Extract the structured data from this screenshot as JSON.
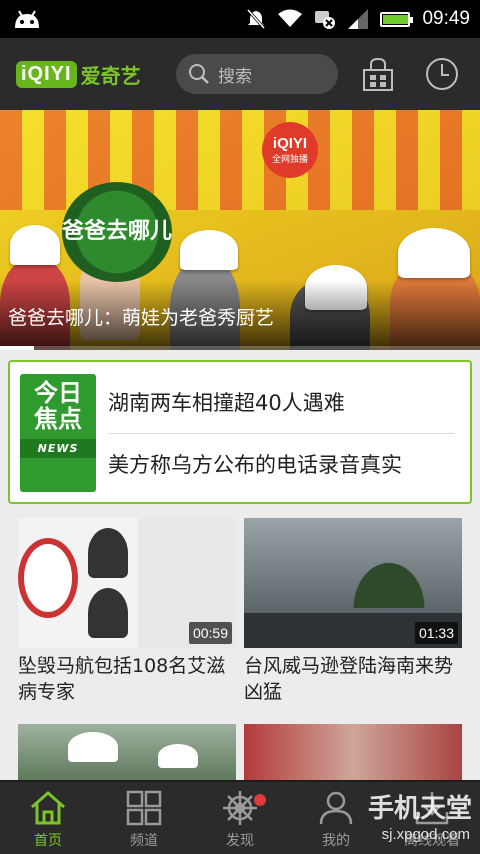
{
  "status_bar": {
    "time": "09:49",
    "battery_level": 0.95,
    "icons": [
      "android-icon",
      "mute-icon",
      "wifi-icon",
      "sync-off-icon",
      "signal-icon",
      "battery-icon"
    ]
  },
  "header": {
    "logo_mark": "iQIYI",
    "logo_name": "爱奇艺",
    "search_placeholder": "搜索",
    "icons": [
      "search-icon",
      "app-store-icon",
      "history-clock-icon"
    ]
  },
  "banner": {
    "title": "爸爸去哪儿：萌娃为老爸秀厨艺",
    "show_logo_text": "爸爸去哪儿",
    "badge_brand": "iQIYI",
    "badge_text": "全网独播",
    "progress": 0.07
  },
  "news": {
    "badge_line1": "今日",
    "badge_line2": "焦点",
    "badge_line3": "NEWS",
    "items": [
      "湖南两车相撞超40人遇难",
      "美方称乌方公布的电话录音真实"
    ]
  },
  "videos": [
    {
      "title": "坠毁马航包括108名艾滋病专家",
      "duration": "00:59"
    },
    {
      "title": "台风威马逊登陆海南来势凶猛",
      "duration": "01:33"
    },
    {
      "title": "",
      "duration": ""
    },
    {
      "title": "",
      "duration": ""
    }
  ],
  "bottom_nav": [
    {
      "label": "首页",
      "icon": "home-icon",
      "active": true
    },
    {
      "label": "频道",
      "icon": "grid-icon",
      "active": false
    },
    {
      "label": "发现",
      "icon": "compass-wheel-icon",
      "active": false,
      "badge": true
    },
    {
      "label": "我的",
      "icon": "user-icon",
      "active": false
    },
    {
      "label": "离线观看",
      "icon": "download-icon",
      "active": false
    }
  ],
  "watermark": {
    "line1": "手机天堂",
    "line2": "sj.xpgod.com"
  },
  "colors": {
    "accent": "#7bc52a",
    "header_bg": "#2b2b2b",
    "badge_red": "#e03a3a"
  }
}
